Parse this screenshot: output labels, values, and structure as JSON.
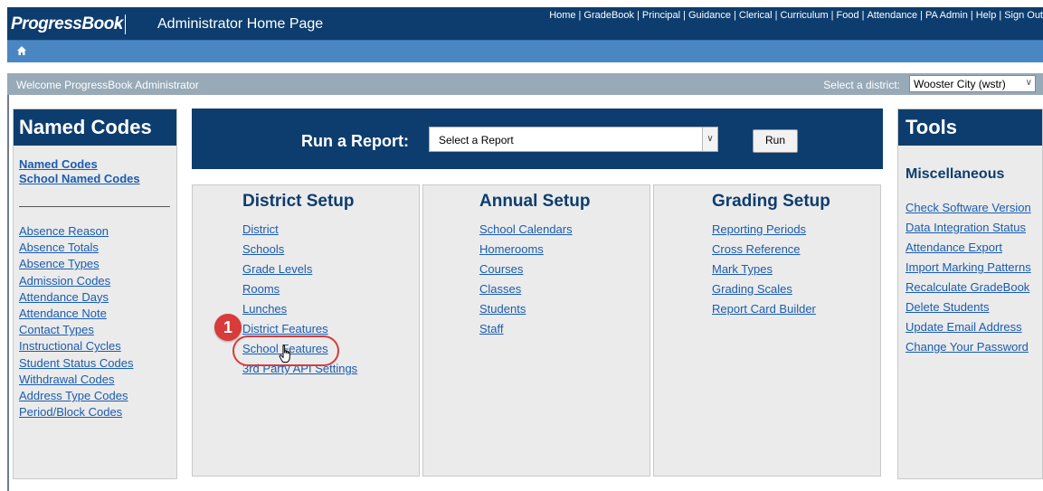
{
  "header": {
    "logo": "ProgressBook",
    "title": "Administrator Home Page",
    "nav": [
      "Home",
      "GradeBook",
      "Principal",
      "Guidance",
      "Clerical",
      "Curriculum",
      "Food",
      "Attendance",
      "PA Admin",
      "Help",
      "Sign Out"
    ]
  },
  "breadcrumb": {
    "icon": "home-icon"
  },
  "welcome": {
    "text": "Welcome ProgressBook Administrator",
    "district_label": "Select a district:",
    "district_value": "Wooster City (wstr)"
  },
  "named_codes": {
    "title": "Named Codes",
    "top_links": [
      "Named Codes",
      "School Named Codes"
    ],
    "links": [
      "Absence Reason",
      "Absence Totals",
      "Absence Types",
      "Admission Codes",
      "Attendance Days",
      "Attendance Note",
      "Contact Types",
      "Instructional Cycles",
      "Student Status Codes",
      "Withdrawal Codes",
      "Address Type Codes",
      "Period/Block Codes"
    ]
  },
  "report": {
    "label": "Run a Report:",
    "select_value": "Select a Report",
    "run_label": "Run"
  },
  "district_setup": {
    "title": "District Setup",
    "links": [
      "District",
      "Schools",
      "Grade Levels",
      "Rooms",
      "Lunches",
      "District Features",
      "School Features",
      "3rd Party API Settings"
    ]
  },
  "annual_setup": {
    "title": "Annual Setup",
    "links": [
      "School Calendars",
      "Homerooms",
      "Courses",
      "Classes",
      "Students",
      "Staff"
    ]
  },
  "grading_setup": {
    "title": "Grading Setup",
    "links": [
      "Reporting Periods",
      "Cross Reference",
      "Mark Types",
      "Grading Scales",
      "Report Card Builder"
    ]
  },
  "tools": {
    "title": "Tools",
    "section": "Miscellaneous",
    "links": [
      "Check Software Version",
      "Data Integration Status",
      "Attendance Export",
      "Import Marking Patterns",
      "Recalculate GradeBook",
      "Delete Students",
      "Update Email Address",
      "Change Your Password"
    ]
  },
  "callout": {
    "number": "1",
    "color": "#d93a3a"
  },
  "colors": {
    "navy": "#0d3d6e",
    "link": "#1a5cb0",
    "breadcrumb": "#4a87c2",
    "welcome": "#98a9b7"
  }
}
